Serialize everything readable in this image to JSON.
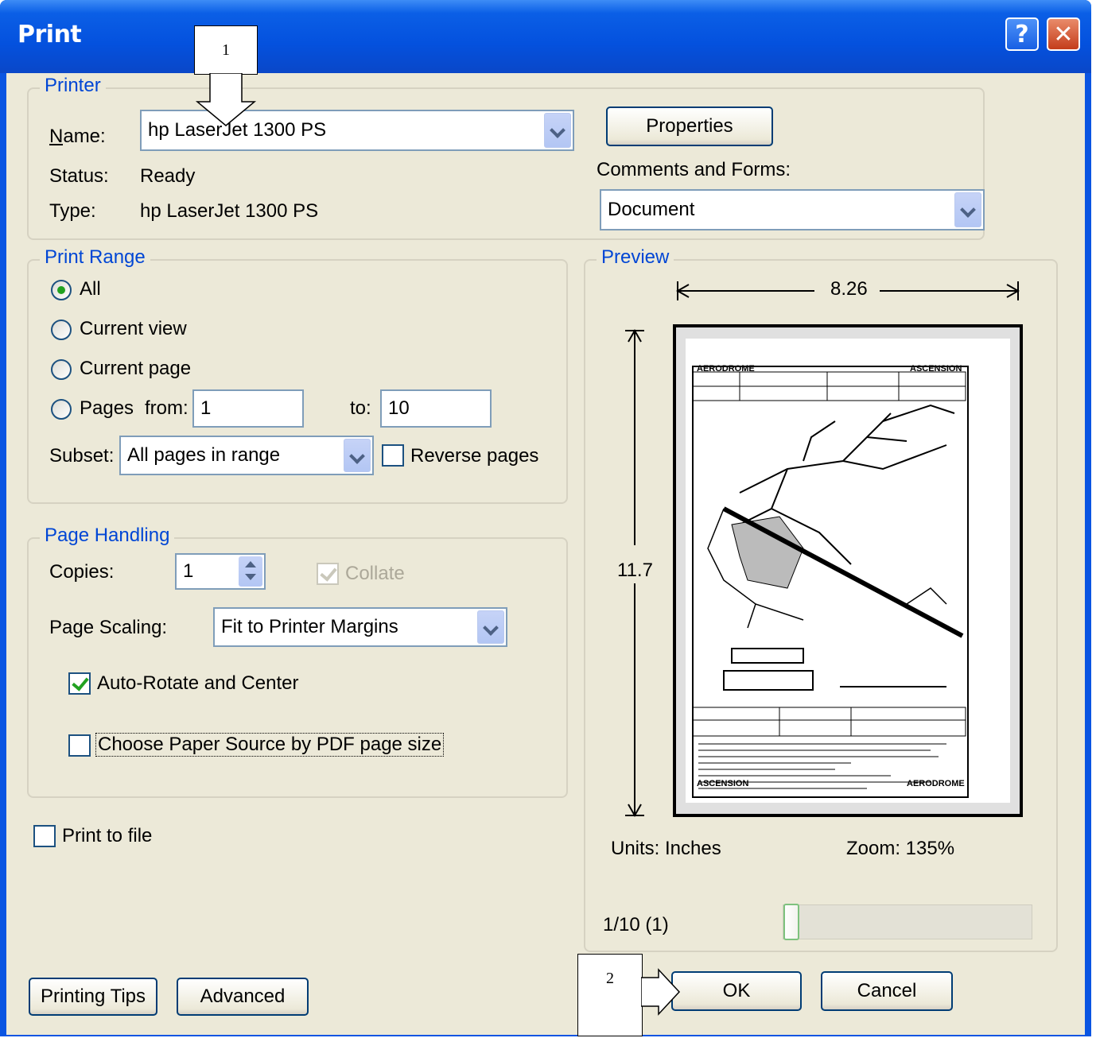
{
  "window": {
    "title": "Print",
    "help_glyph": "?",
    "close_glyph": "✕"
  },
  "annotations": {
    "callout_1": "1",
    "callout_2": "2"
  },
  "printer": {
    "group_title": "Printer",
    "name_label": "Name:",
    "name_value": "hp LaserJet 1300 PS",
    "status_label": "Status:",
    "status_value": "Ready",
    "type_label": "Type:",
    "type_value": "hp LaserJet 1300 PS",
    "properties_button": "Properties",
    "comments_label": "Comments and Forms:",
    "comments_value": "Document"
  },
  "print_range": {
    "group_title": "Print Range",
    "all_label": "All",
    "current_view_label": "Current view",
    "current_page_label": "Current page",
    "pages_label": "Pages",
    "from_label": "from:",
    "from_value": "1",
    "to_label": "to:",
    "to_value": "10",
    "subset_label": "Subset:",
    "subset_value": "All pages in range",
    "reverse_label": "Reverse pages",
    "selected": "All"
  },
  "page_handling": {
    "group_title": "Page Handling",
    "copies_label": "Copies:",
    "copies_value": "1",
    "collate_label": "Collate",
    "scaling_label": "Page Scaling:",
    "scaling_value": "Fit to Printer Margins",
    "auto_rotate_label": "Auto-Rotate and Center",
    "auto_rotate_checked": true,
    "paper_source_label": "Choose Paper Source by PDF page size",
    "paper_source_checked": false
  },
  "print_to_file": {
    "label": "Print to file",
    "checked": false
  },
  "preview": {
    "group_title": "Preview",
    "width_dim": "8.26",
    "height_dim": "11.7",
    "units": "Units: Inches",
    "zoom": "Zoom: 135%",
    "page_indicator": "1/10 (1)",
    "slider_position": 0.0,
    "doc_top_left": "AERODROME",
    "doc_top_right": "ASCENSION",
    "doc_bottom_left": "ASCENSION",
    "doc_bottom_right": "AERODROME"
  },
  "buttons": {
    "printing_tips": "Printing Tips",
    "advanced": "Advanced",
    "ok": "OK",
    "cancel": "Cancel"
  }
}
